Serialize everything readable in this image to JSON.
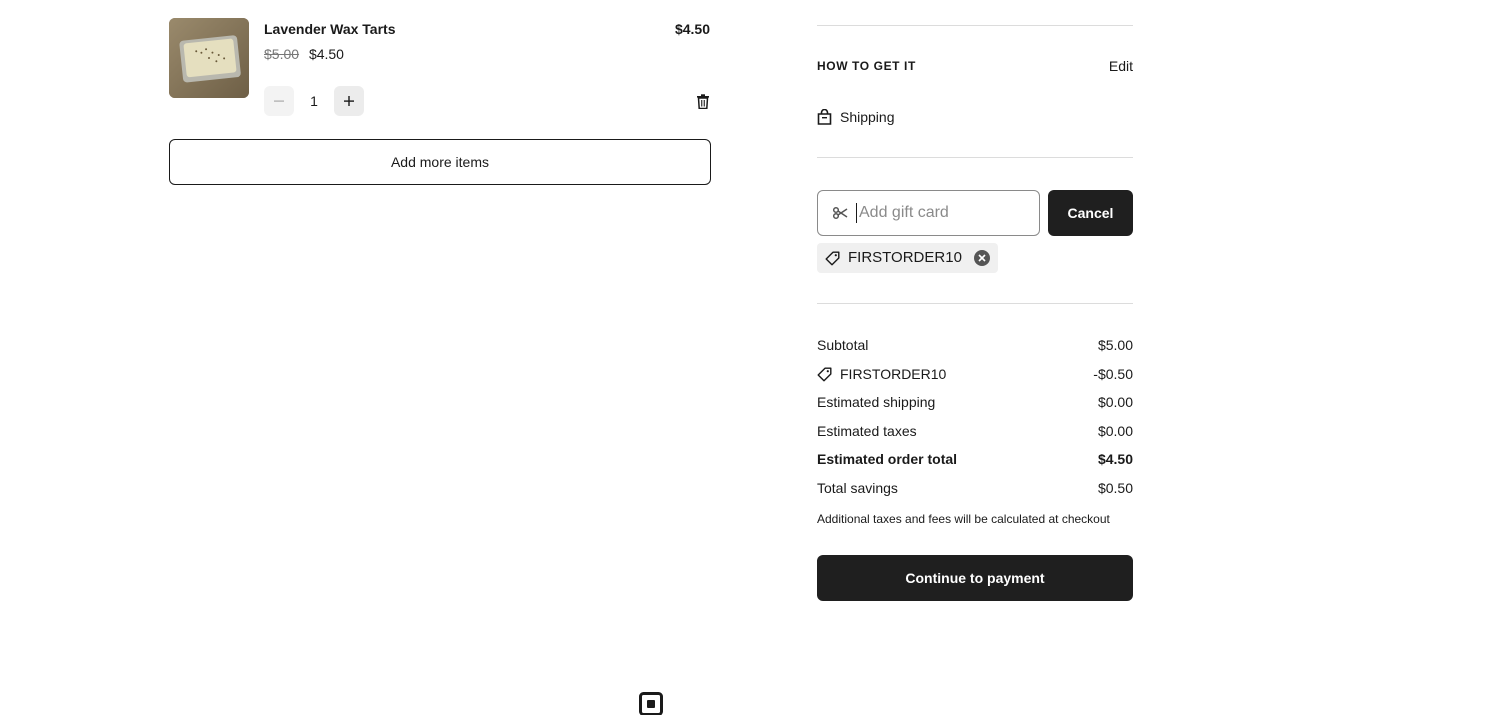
{
  "cart_item": {
    "name": "Lavender Wax Tarts",
    "line_price": "$4.50",
    "original_price": "$5.00",
    "sale_price": "$4.50",
    "quantity": "1"
  },
  "add_more_label": "Add more items",
  "fulfillment": {
    "title": "HOW TO GET IT",
    "edit_label": "Edit",
    "method": "Shipping"
  },
  "gift_card": {
    "placeholder": "Add gift card",
    "value": "",
    "cancel_label": "Cancel"
  },
  "promo_code": "FIRSTORDER10",
  "summary": {
    "subtotal_label": "Subtotal",
    "subtotal_value": "$5.00",
    "discount_label": "FIRSTORDER10",
    "discount_value": "-$0.50",
    "shipping_label": "Estimated shipping",
    "shipping_value": "$0.00",
    "taxes_label": "Estimated taxes",
    "taxes_value": "$0.00",
    "total_label": "Estimated order total",
    "total_value": "$4.50",
    "savings_label": "Total savings",
    "savings_value": "$0.50",
    "note": "Additional taxes and fees will be calculated at checkout"
  },
  "continue_label": "Continue to payment",
  "icons": {
    "thumbnail": "product-image",
    "minus": "minus-icon",
    "plus": "plus-icon",
    "trash": "trash-icon",
    "shipping": "shipping-bag-icon",
    "gift": "gift-card-icon",
    "tag": "tag-icon",
    "remove": "close-circle-icon",
    "logo": "square-logo-icon"
  },
  "colors": {
    "primary_button": "#1f1f1f",
    "divider": "#dcdcdc",
    "chip_background": "#f0f0f0"
  }
}
